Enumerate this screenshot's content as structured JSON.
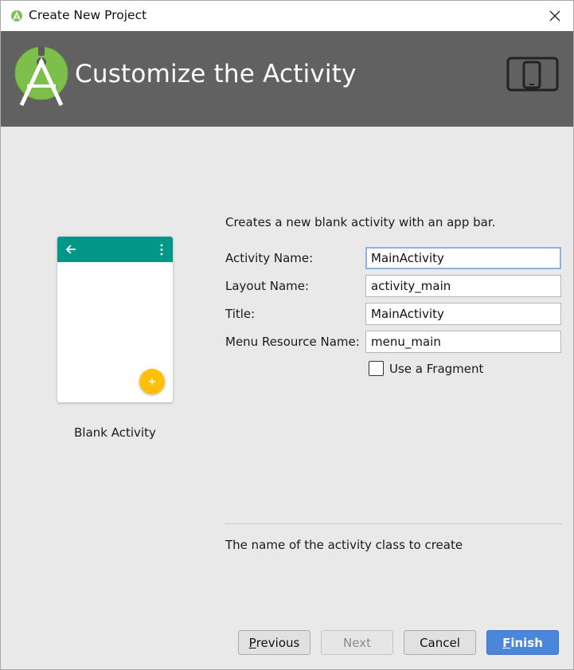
{
  "window": {
    "title": "Create New Project",
    "app_icon": "android-studio-icon",
    "close_icon": "close-icon"
  },
  "banner": {
    "heading": "Customize the Activity",
    "logo": "android-studio-logo",
    "device_icon": "devices-icon",
    "color": "#616161"
  },
  "template": {
    "label": "Blank Activity",
    "appbar_color": "#009688",
    "fab_color": "#FFC107",
    "back_icon": "arrow-back-icon",
    "menu_icon": "overflow-menu-icon",
    "fab_icon": "plus-icon"
  },
  "form": {
    "description": "Creates a new blank activity with an app bar.",
    "fields": [
      {
        "label": "Activity Name:",
        "value": "MainActivity"
      },
      {
        "label": "Layout Name:",
        "value": "activity_main"
      },
      {
        "label": "Title:",
        "value": "MainActivity"
      },
      {
        "label": "Menu Resource Name:",
        "value": "menu_main"
      }
    ],
    "fragment_checkbox": {
      "label": "Use a Fragment",
      "checked": false
    }
  },
  "help_text": "The name of the activity class to create",
  "buttons": {
    "previous": {
      "mnemonic": "P",
      "rest": "revious"
    },
    "next": {
      "label": "Next"
    },
    "cancel": {
      "label": "Cancel"
    },
    "finish": {
      "mnemonic": "F",
      "rest": "inish"
    }
  },
  "colors": {
    "primary_button": "#4A86D9",
    "focus_border": "#8FB3E0"
  }
}
